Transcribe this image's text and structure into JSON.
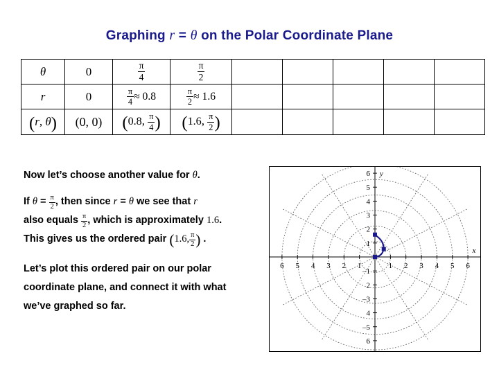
{
  "title": {
    "text_before": "Graphing ",
    "var_r": "r",
    "equals": " = ",
    "var_theta": "θ",
    "text_after": " on the Polar Coordinate Plane",
    "color": "#1a1a8c"
  },
  "table": {
    "columns": 9,
    "rows": [
      {
        "label": "θ",
        "cells": [
          {
            "text": "0",
            "kind": "plain",
            "color": "#000000"
          },
          {
            "frac_num": "π",
            "frac_den": "4",
            "kind": "fraction",
            "color": "#000000"
          },
          {
            "frac_num": "π",
            "frac_den": "2",
            "kind": "fraction",
            "color": "#1a1a8c"
          },
          {
            "text": "",
            "kind": "empty"
          },
          {
            "text": "",
            "kind": "empty"
          },
          {
            "text": "",
            "kind": "empty"
          },
          {
            "text": "",
            "kind": "empty"
          },
          {
            "text": "",
            "kind": "empty"
          }
        ]
      },
      {
        "label": "r",
        "cells": [
          {
            "text": "0",
            "kind": "plain",
            "color": "#000000"
          },
          {
            "frac_num": "π",
            "frac_den": "4",
            "approx": "≈ 0.8",
            "kind": "fraction-approx",
            "color": "#000000"
          },
          {
            "frac_num": "π",
            "frac_den": "2",
            "approx": "≈ 1.6",
            "kind": "fraction-approx",
            "color": "#1a1a8c"
          },
          {
            "text": "",
            "kind": "empty"
          },
          {
            "text": "",
            "kind": "empty"
          },
          {
            "text": "",
            "kind": "empty"
          },
          {
            "text": "",
            "kind": "empty"
          },
          {
            "text": "",
            "kind": "empty"
          }
        ]
      },
      {
        "label": "(r, θ)",
        "cells": [
          {
            "text": "(0, 0)",
            "kind": "pair-plain",
            "color": "#000000"
          },
          {
            "radius": "0.8",
            "frac_num": "π",
            "frac_den": "4",
            "kind": "pair-fraction",
            "color": "#000000"
          },
          {
            "radius": "1.6",
            "frac_num": "π",
            "frac_den": "2",
            "kind": "pair-fraction",
            "color": "#1a1a8c"
          },
          {
            "text": "",
            "kind": "empty"
          },
          {
            "text": "",
            "kind": "empty"
          },
          {
            "text": "",
            "kind": "empty"
          },
          {
            "text": "",
            "kind": "empty"
          },
          {
            "text": "",
            "kind": "empty"
          }
        ]
      }
    ]
  },
  "body": {
    "para_1": {
      "before": "Now let’s choose another value for ",
      "symbol": "θ",
      "after": "."
    },
    "para_2": {
      "seg_1": "If ",
      "theta": "θ",
      "seg_2": " = ",
      "frac_num": "π",
      "frac_den": "2",
      "seg_3": ", then since ",
      "r_1": "r",
      "seg_4": " = ",
      "theta_2": "θ",
      "seg_5": " we see that ",
      "r_2": "r",
      "seg_6": "also equals ",
      "frac2_num": "π",
      "frac2_den": "2",
      "seg_7": ", which is approximately ",
      "value": "1.6",
      "seg_8": ".",
      "seg_9": "This gives us the ordered pair ",
      "pair_radius": "1.6",
      "pair_frac_num": "π",
      "pair_frac_den": "2",
      "seg_10": " ."
    },
    "para_3": {
      "line_1": "Let’s plot this ordered pair on our polar",
      "line_2": "coordinate plane, and connect it with what",
      "line_3": "we’ve graphed so far."
    }
  },
  "chart_data": {
    "type": "line",
    "title": "",
    "plot_kind": "polar-grid-on-cartesian-axes",
    "xlabel": "x",
    "ylabel": "y",
    "xlim": [
      -6.8,
      6.8
    ],
    "ylim": [
      -6.6,
      6.6
    ],
    "x_ticks": [
      -6,
      -5,
      -4,
      -3,
      -2,
      -1,
      1,
      2,
      3,
      4,
      5,
      6
    ],
    "x_tick_labels": [
      "6",
      "5",
      "4",
      "3",
      "2",
      "1",
      "1",
      "2",
      "3",
      "4",
      "5",
      "6"
    ],
    "y_ticks": [
      6,
      5,
      4,
      3,
      2,
      1,
      -1,
      -2,
      -3,
      -4,
      -5,
      -6
    ],
    "y_tick_labels": [
      "6",
      "5",
      "4",
      "3",
      "2",
      "1",
      "–1",
      "2",
      "–3",
      "4",
      "–5",
      "6"
    ],
    "grid": true,
    "grid_style": "dotted polar: concentric circles + radial spokes",
    "polar_circle_radii": [
      1,
      2,
      3,
      4,
      5,
      6
    ],
    "polar_spoke_degrees": [
      0,
      30,
      60,
      90,
      120,
      150,
      180,
      210,
      240,
      270,
      300,
      330
    ],
    "legend": null,
    "series": [
      {
        "name": "r = θ",
        "color": "#1a1a8c",
        "equation": "r = theta",
        "theta_range_radians": [
          0,
          1.5708
        ],
        "points_polar": [
          {
            "r": 0,
            "theta": 0
          },
          {
            "r": 0.8,
            "theta": 0.7854
          },
          {
            "r": 1.6,
            "theta": 1.5708
          }
        ],
        "points_cartesian": [
          {
            "x": 0,
            "y": 0
          },
          {
            "x": 0.57,
            "y": 0.57
          },
          {
            "x": 0,
            "y": 1.6
          }
        ],
        "marker": "square",
        "marked_points": [
          {
            "x": 0,
            "y": 0
          },
          {
            "x": 0.57,
            "y": 0.57
          },
          {
            "x": 0,
            "y": 1.6
          }
        ]
      }
    ]
  }
}
